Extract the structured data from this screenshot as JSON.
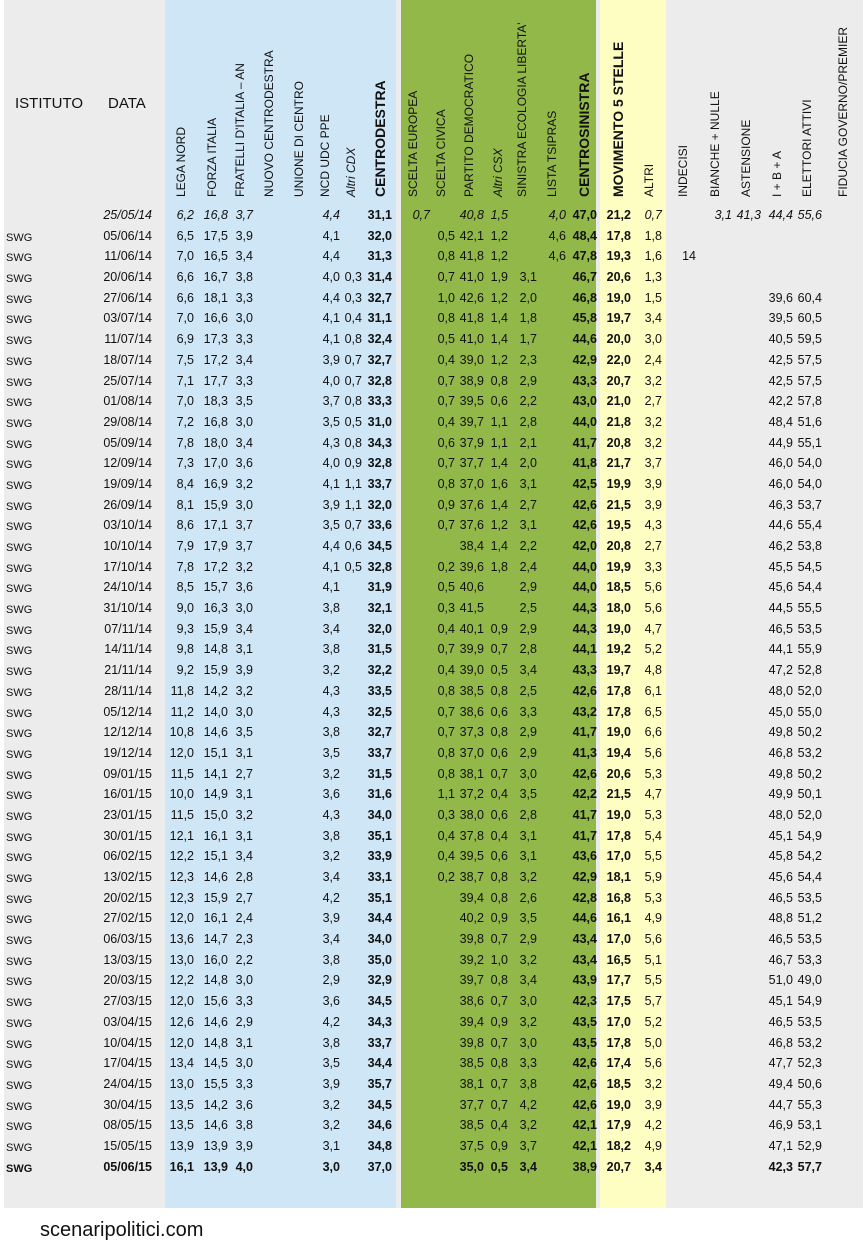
{
  "headers": {
    "istituto": "ISTITUTO",
    "data": "DATA",
    "cols": [
      "LEGA NORD",
      "FORZA ITALIA",
      "FRATELLI D'ITALIA – AN",
      "NUOVO CENTRODESTRA",
      "UNIONE DI CENTRO",
      "NCD UDC PPE",
      "Altri CDX",
      "CENTRODESTRA",
      "SCELTA EUROPEA",
      "SCELTA CIVICA",
      "PARTITO DEMOCRATICO",
      "Altri CSX",
      "SINISTRA ECOLOGIA LIBERTA'",
      "LISTA TSIPRAS",
      "CENTROSINISTRA",
      "MOVIMENTO 5 STELLE",
      "ALTRI",
      "INDECISI",
      "BIANCHE + NULLE",
      "ASTENSIONE",
      "I + B + A",
      "ELETTORI ATTIVI",
      "FIDUCIA GOVERNO/PREMIER"
    ]
  },
  "rows": [
    [
      "",
      "25/05/14",
      "6,2",
      "16,8",
      "3,7",
      "",
      "",
      "4,4",
      "",
      "31,1",
      "0,7",
      "",
      "40,8",
      "1,5",
      "",
      "4,0",
      "47,0",
      "21,2",
      "0,7",
      "",
      "3,1",
      "41,3",
      "44,4",
      "55,6",
      ""
    ],
    [
      "SWG",
      "05/06/14",
      "6,5",
      "17,5",
      "3,9",
      "",
      "",
      "4,1",
      "",
      "32,0",
      "",
      "0,5",
      "42,1",
      "1,2",
      "",
      "4,6",
      "48,4",
      "17,8",
      "1,8",
      "",
      "",
      "",
      "",
      "",
      ""
    ],
    [
      "SWG",
      "11/06/14",
      "7,0",
      "16,5",
      "3,4",
      "",
      "",
      "4,4",
      "",
      "31,3",
      "",
      "0,8",
      "41,8",
      "1,2",
      "",
      "4,6",
      "47,8",
      "19,3",
      "1,6",
      "14",
      "",
      "",
      "",
      "",
      ""
    ],
    [
      "SWG",
      "20/06/14",
      "6,6",
      "16,7",
      "3,8",
      "",
      "",
      "4,0",
      "0,3",
      "31,4",
      "",
      "0,7",
      "41,0",
      "1,9",
      "3,1",
      "",
      "46,7",
      "20,6",
      "1,3",
      "",
      "",
      "",
      "",
      "",
      ""
    ],
    [
      "SWG",
      "27/06/14",
      "6,6",
      "18,1",
      "3,3",
      "",
      "",
      "4,4",
      "0,3",
      "32,7",
      "",
      "1,0",
      "42,6",
      "1,2",
      "2,0",
      "",
      "46,8",
      "19,0",
      "1,5",
      "",
      "",
      "",
      "39,6",
      "60,4",
      ""
    ],
    [
      "SWG",
      "03/07/14",
      "7,0",
      "16,6",
      "3,0",
      "",
      "",
      "4,1",
      "0,4",
      "31,1",
      "",
      "0,8",
      "41,8",
      "1,4",
      "1,8",
      "",
      "45,8",
      "19,7",
      "3,4",
      "",
      "",
      "",
      "39,5",
      "60,5",
      ""
    ],
    [
      "SWG",
      "11/07/14",
      "6,9",
      "17,3",
      "3,3",
      "",
      "",
      "4,1",
      "0,8",
      "32,4",
      "",
      "0,5",
      "41,0",
      "1,4",
      "1,7",
      "",
      "44,6",
      "20,0",
      "3,0",
      "",
      "",
      "",
      "40,5",
      "59,5",
      ""
    ],
    [
      "SWG",
      "18/07/14",
      "7,5",
      "17,2",
      "3,4",
      "",
      "",
      "3,9",
      "0,7",
      "32,7",
      "",
      "0,4",
      "39,0",
      "1,2",
      "2,3",
      "",
      "42,9",
      "22,0",
      "2,4",
      "",
      "",
      "",
      "42,5",
      "57,5",
      ""
    ],
    [
      "SWG",
      "25/07/14",
      "7,1",
      "17,7",
      "3,3",
      "",
      "",
      "4,0",
      "0,7",
      "32,8",
      "",
      "0,7",
      "38,9",
      "0,8",
      "2,9",
      "",
      "43,3",
      "20,7",
      "3,2",
      "",
      "",
      "",
      "42,5",
      "57,5",
      ""
    ],
    [
      "SWG",
      "01/08/14",
      "7,0",
      "18,3",
      "3,5",
      "",
      "",
      "3,7",
      "0,8",
      "33,3",
      "",
      "0,7",
      "39,5",
      "0,6",
      "2,2",
      "",
      "43,0",
      "21,0",
      "2,7",
      "",
      "",
      "",
      "42,2",
      "57,8",
      ""
    ],
    [
      "SWG",
      "29/08/14",
      "7,2",
      "16,8",
      "3,0",
      "",
      "",
      "3,5",
      "0,5",
      "31,0",
      "",
      "0,4",
      "39,7",
      "1,1",
      "2,8",
      "",
      "44,0",
      "21,8",
      "3,2",
      "",
      "",
      "",
      "48,4",
      "51,6",
      ""
    ],
    [
      "SWG",
      "05/09/14",
      "7,8",
      "18,0",
      "3,4",
      "",
      "",
      "4,3",
      "0,8",
      "34,3",
      "",
      "0,6",
      "37,9",
      "1,1",
      "2,1",
      "",
      "41,7",
      "20,8",
      "3,2",
      "",
      "",
      "",
      "44,9",
      "55,1",
      ""
    ],
    [
      "SWG",
      "12/09/14",
      "7,3",
      "17,0",
      "3,6",
      "",
      "",
      "4,0",
      "0,9",
      "32,8",
      "",
      "0,7",
      "37,7",
      "1,4",
      "2,0",
      "",
      "41,8",
      "21,7",
      "3,7",
      "",
      "",
      "",
      "46,0",
      "54,0",
      ""
    ],
    [
      "SWG",
      "19/09/14",
      "8,4",
      "16,9",
      "3,2",
      "",
      "",
      "4,1",
      "1,1",
      "33,7",
      "",
      "0,8",
      "37,0",
      "1,6",
      "3,1",
      "",
      "42,5",
      "19,9",
      "3,9",
      "",
      "",
      "",
      "46,0",
      "54,0",
      ""
    ],
    [
      "SWG",
      "26/09/14",
      "8,1",
      "15,9",
      "3,0",
      "",
      "",
      "3,9",
      "1,1",
      "32,0",
      "",
      "0,9",
      "37,6",
      "1,4",
      "2,7",
      "",
      "42,6",
      "21,5",
      "3,9",
      "",
      "",
      "",
      "46,3",
      "53,7",
      ""
    ],
    [
      "SWG",
      "03/10/14",
      "8,6",
      "17,1",
      "3,7",
      "",
      "",
      "3,5",
      "0,7",
      "33,6",
      "",
      "0,7",
      "37,6",
      "1,2",
      "3,1",
      "",
      "42,6",
      "19,5",
      "4,3",
      "",
      "",
      "",
      "44,6",
      "55,4",
      ""
    ],
    [
      "SWG",
      "10/10/14",
      "7,9",
      "17,9",
      "3,7",
      "",
      "",
      "4,4",
      "0,6",
      "34,5",
      "",
      "",
      "38,4",
      "1,4",
      "2,2",
      "",
      "42,0",
      "20,8",
      "2,7",
      "",
      "",
      "",
      "46,2",
      "53,8",
      ""
    ],
    [
      "SWG",
      "17/10/14",
      "7,8",
      "17,2",
      "3,2",
      "",
      "",
      "4,1",
      "0,5",
      "32,8",
      "",
      "0,2",
      "39,6",
      "1,8",
      "2,4",
      "",
      "44,0",
      "19,9",
      "3,3",
      "",
      "",
      "",
      "45,5",
      "54,5",
      ""
    ],
    [
      "SWG",
      "24/10/14",
      "8,5",
      "15,7",
      "3,6",
      "",
      "",
      "4,1",
      "",
      "31,9",
      "",
      "0,5",
      "40,6",
      "",
      "2,9",
      "",
      "44,0",
      "18,5",
      "5,6",
      "",
      "",
      "",
      "45,6",
      "54,4",
      ""
    ],
    [
      "SWG",
      "31/10/14",
      "9,0",
      "16,3",
      "3,0",
      "",
      "",
      "3,8",
      "",
      "32,1",
      "",
      "0,3",
      "41,5",
      "",
      "2,5",
      "",
      "44,3",
      "18,0",
      "5,6",
      "",
      "",
      "",
      "44,5",
      "55,5",
      ""
    ],
    [
      "SWG",
      "07/11/14",
      "9,3",
      "15,9",
      "3,4",
      "",
      "",
      "3,4",
      "",
      "32,0",
      "",
      "0,4",
      "40,1",
      "0,9",
      "2,9",
      "",
      "44,3",
      "19,0",
      "4,7",
      "",
      "",
      "",
      "46,5",
      "53,5",
      ""
    ],
    [
      "SWG",
      "14/11/14",
      "9,8",
      "14,8",
      "3,1",
      "",
      "",
      "3,8",
      "",
      "31,5",
      "",
      "0,7",
      "39,9",
      "0,7",
      "2,8",
      "",
      "44,1",
      "19,2",
      "5,2",
      "",
      "",
      "",
      "44,1",
      "55,9",
      ""
    ],
    [
      "SWG",
      "21/11/14",
      "9,2",
      "15,9",
      "3,9",
      "",
      "",
      "3,2",
      "",
      "32,2",
      "",
      "0,4",
      "39,0",
      "0,5",
      "3,4",
      "",
      "43,3",
      "19,7",
      "4,8",
      "",
      "",
      "",
      "47,2",
      "52,8",
      ""
    ],
    [
      "SWG",
      "28/11/14",
      "11,8",
      "14,2",
      "3,2",
      "",
      "",
      "4,3",
      "",
      "33,5",
      "",
      "0,8",
      "38,5",
      "0,8",
      "2,5",
      "",
      "42,6",
      "17,8",
      "6,1",
      "",
      "",
      "",
      "48,0",
      "52,0",
      ""
    ],
    [
      "SWG",
      "05/12/14",
      "11,2",
      "14,0",
      "3,0",
      "",
      "",
      "4,3",
      "",
      "32,5",
      "",
      "0,7",
      "38,6",
      "0,6",
      "3,3",
      "",
      "43,2",
      "17,8",
      "6,5",
      "",
      "",
      "",
      "45,0",
      "55,0",
      ""
    ],
    [
      "SWG",
      "12/12/14",
      "10,8",
      "14,6",
      "3,5",
      "",
      "",
      "3,8",
      "",
      "32,7",
      "",
      "0,7",
      "37,3",
      "0,8",
      "2,9",
      "",
      "41,7",
      "19,0",
      "6,6",
      "",
      "",
      "",
      "49,8",
      "50,2",
      ""
    ],
    [
      "SWG",
      "19/12/14",
      "12,0",
      "15,1",
      "3,1",
      "",
      "",
      "3,5",
      "",
      "33,7",
      "",
      "0,8",
      "37,0",
      "0,6",
      "2,9",
      "",
      "41,3",
      "19,4",
      "5,6",
      "",
      "",
      "",
      "46,8",
      "53,2",
      ""
    ],
    [
      "SWG",
      "09/01/15",
      "11,5",
      "14,1",
      "2,7",
      "",
      "",
      "3,2",
      "",
      "31,5",
      "",
      "0,8",
      "38,1",
      "0,7",
      "3,0",
      "",
      "42,6",
      "20,6",
      "5,3",
      "",
      "",
      "",
      "49,8",
      "50,2",
      ""
    ],
    [
      "SWG",
      "16/01/15",
      "10,0",
      "14,9",
      "3,1",
      "",
      "",
      "3,6",
      "",
      "31,6",
      "",
      "1,1",
      "37,2",
      "0,4",
      "3,5",
      "",
      "42,2",
      "21,5",
      "4,7",
      "",
      "",
      "",
      "49,9",
      "50,1",
      ""
    ],
    [
      "SWG",
      "23/01/15",
      "11,5",
      "15,0",
      "3,2",
      "",
      "",
      "4,3",
      "",
      "34,0",
      "",
      "0,3",
      "38,0",
      "0,6",
      "2,8",
      "",
      "41,7",
      "19,0",
      "5,3",
      "",
      "",
      "",
      "48,0",
      "52,0",
      ""
    ],
    [
      "SWG",
      "30/01/15",
      "12,1",
      "16,1",
      "3,1",
      "",
      "",
      "3,8",
      "",
      "35,1",
      "",
      "0,4",
      "37,8",
      "0,4",
      "3,1",
      "",
      "41,7",
      "17,8",
      "5,4",
      "",
      "",
      "",
      "45,1",
      "54,9",
      ""
    ],
    [
      "SWG",
      "06/02/15",
      "12,2",
      "15,1",
      "3,4",
      "",
      "",
      "3,2",
      "",
      "33,9",
      "",
      "0,4",
      "39,5",
      "0,6",
      "3,1",
      "",
      "43,6",
      "17,0",
      "5,5",
      "",
      "",
      "",
      "45,8",
      "54,2",
      ""
    ],
    [
      "SWG",
      "13/02/15",
      "12,3",
      "14,6",
      "2,8",
      "",
      "",
      "3,4",
      "",
      "33,1",
      "",
      "0,2",
      "38,7",
      "0,8",
      "3,2",
      "",
      "42,9",
      "18,1",
      "5,9",
      "",
      "",
      "",
      "45,6",
      "54,4",
      ""
    ],
    [
      "SWG",
      "20/02/15",
      "12,3",
      "15,9",
      "2,7",
      "",
      "",
      "4,2",
      "",
      "35,1",
      "",
      "",
      "39,4",
      "0,8",
      "2,6",
      "",
      "42,8",
      "16,8",
      "5,3",
      "",
      "",
      "",
      "46,5",
      "53,5",
      ""
    ],
    [
      "SWG",
      "27/02/15",
      "12,0",
      "16,1",
      "2,4",
      "",
      "",
      "3,9",
      "",
      "34,4",
      "",
      "",
      "40,2",
      "0,9",
      "3,5",
      "",
      "44,6",
      "16,1",
      "4,9",
      "",
      "",
      "",
      "48,8",
      "51,2",
      ""
    ],
    [
      "SWG",
      "06/03/15",
      "13,6",
      "14,7",
      "2,3",
      "",
      "",
      "3,4",
      "",
      "34,0",
      "",
      "",
      "39,8",
      "0,7",
      "2,9",
      "",
      "43,4",
      "17,0",
      "5,6",
      "",
      "",
      "",
      "46,5",
      "53,5",
      ""
    ],
    [
      "SWG",
      "13/03/15",
      "13,0",
      "16,0",
      "2,2",
      "",
      "",
      "3,8",
      "",
      "35,0",
      "",
      "",
      "39,2",
      "1,0",
      "3,2",
      "",
      "43,4",
      "16,5",
      "5,1",
      "",
      "",
      "",
      "46,7",
      "53,3",
      ""
    ],
    [
      "SWG",
      "20/03/15",
      "12,2",
      "14,8",
      "3,0",
      "",
      "",
      "2,9",
      "",
      "32,9",
      "",
      "",
      "39,7",
      "0,8",
      "3,4",
      "",
      "43,9",
      "17,7",
      "5,5",
      "",
      "",
      "",
      "51,0",
      "49,0",
      ""
    ],
    [
      "SWG",
      "27/03/15",
      "12,0",
      "15,6",
      "3,3",
      "",
      "",
      "3,6",
      "",
      "34,5",
      "",
      "",
      "38,6",
      "0,7",
      "3,0",
      "",
      "42,3",
      "17,5",
      "5,7",
      "",
      "",
      "",
      "45,1",
      "54,9",
      ""
    ],
    [
      "SWG",
      "03/04/15",
      "12,6",
      "14,6",
      "2,9",
      "",
      "",
      "4,2",
      "",
      "34,3",
      "",
      "",
      "39,4",
      "0,9",
      "3,2",
      "",
      "43,5",
      "17,0",
      "5,2",
      "",
      "",
      "",
      "46,5",
      "53,5",
      ""
    ],
    [
      "SWG",
      "10/04/15",
      "12,0",
      "14,8",
      "3,1",
      "",
      "",
      "3,8",
      "",
      "33,7",
      "",
      "",
      "39,8",
      "0,7",
      "3,0",
      "",
      "43,5",
      "17,8",
      "5,0",
      "",
      "",
      "",
      "46,8",
      "53,2",
      ""
    ],
    [
      "SWG",
      "17/04/15",
      "13,4",
      "14,5",
      "3,0",
      "",
      "",
      "3,5",
      "",
      "34,4",
      "",
      "",
      "38,5",
      "0,8",
      "3,3",
      "",
      "42,6",
      "17,4",
      "5,6",
      "",
      "",
      "",
      "47,7",
      "52,3",
      ""
    ],
    [
      "SWG",
      "24/04/15",
      "13,0",
      "15,5",
      "3,3",
      "",
      "",
      "3,9",
      "",
      "35,7",
      "",
      "",
      "38,1",
      "0,7",
      "3,8",
      "",
      "42,6",
      "18,5",
      "3,2",
      "",
      "",
      "",
      "49,4",
      "50,6",
      ""
    ],
    [
      "SWG",
      "30/04/15",
      "13,5",
      "14,2",
      "3,6",
      "",
      "",
      "3,2",
      "",
      "34,5",
      "",
      "",
      "37,7",
      "0,7",
      "4,2",
      "",
      "42,6",
      "19,0",
      "3,9",
      "",
      "",
      "",
      "44,7",
      "55,3",
      ""
    ],
    [
      "SWG",
      "08/05/15",
      "13,5",
      "14,6",
      "3,8",
      "",
      "",
      "3,2",
      "",
      "34,6",
      "",
      "",
      "38,5",
      "0,4",
      "3,2",
      "",
      "42,1",
      "17,9",
      "4,2",
      "",
      "",
      "",
      "46,9",
      "53,1",
      ""
    ],
    [
      "SWG",
      "15/05/15",
      "13,9",
      "13,9",
      "3,9",
      "",
      "",
      "3,1",
      "",
      "34,8",
      "",
      "",
      "37,5",
      "0,9",
      "3,7",
      "",
      "42,1",
      "18,2",
      "4,9",
      "",
      "",
      "",
      "47,1",
      "52,9",
      ""
    ],
    [
      "SWG",
      "05/06/15",
      "16,1",
      "13,9",
      "4,0",
      "",
      "",
      "3,0",
      "",
      "37,0",
      "",
      "",
      "35,0",
      "0,5",
      "3,4",
      "",
      "38,9",
      "20,7",
      "3,4",
      "",
      "",
      "",
      "42,3",
      "57,7",
      ""
    ]
  ],
  "footer": "scenaripolitici.com",
  "colors": {
    "centrodestra": "#cfe6f6",
    "centrosinistra": "#93b84a",
    "m5s": "#fffec2",
    "background": "#ececec"
  }
}
